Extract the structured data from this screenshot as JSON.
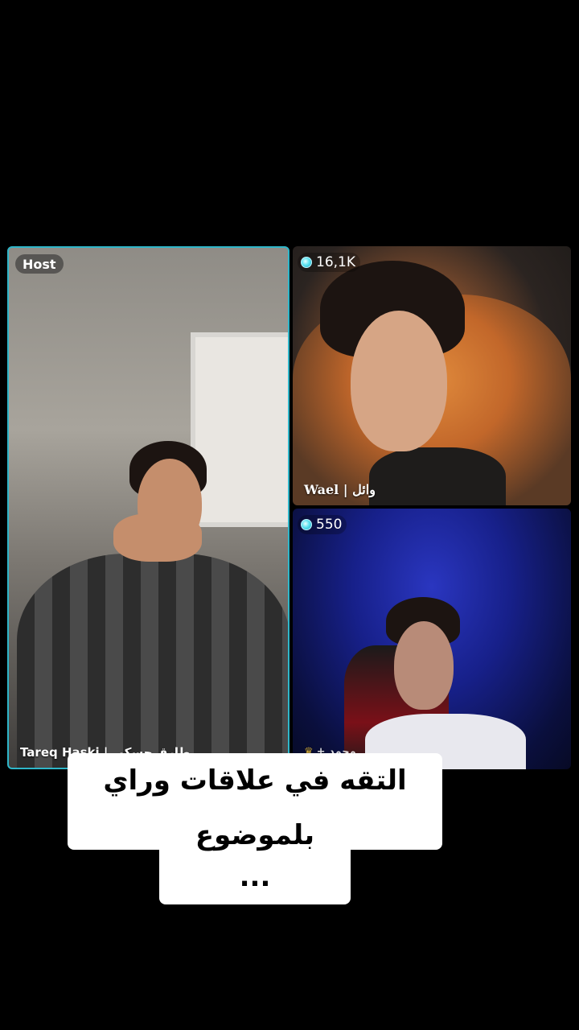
{
  "host": {
    "badge": "Host",
    "name": "Tareq Haski | طارق حسكي"
  },
  "guest1": {
    "gift_count": "16,1K",
    "name": "Wael | وائل"
  },
  "guest2": {
    "gift_count": "550",
    "name": "+ محمد"
  },
  "caption": {
    "line1": "التقه في علاقات وراي وائل",
    "line2": "بلموضوع ..."
  },
  "colors": {
    "host_border": "#2fb6c9",
    "gem": "#5fe3f0"
  }
}
